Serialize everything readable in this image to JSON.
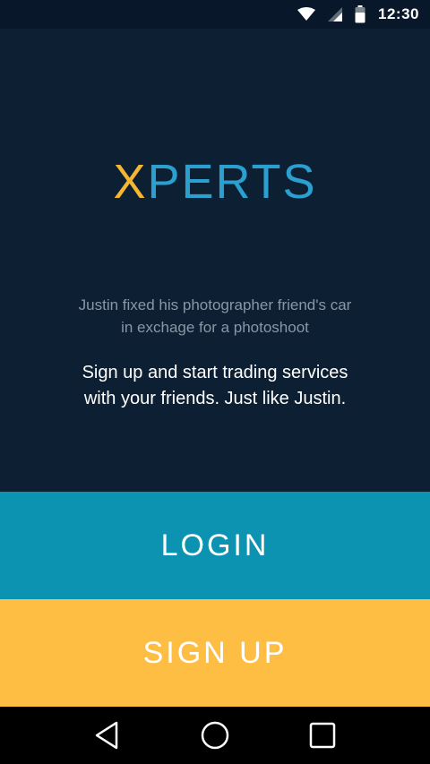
{
  "status_bar": {
    "time": "12:30",
    "icons": [
      "wifi-icon",
      "cell-signal-icon",
      "battery-icon"
    ]
  },
  "logo": {
    "first_letter": "X",
    "rest": "PERTS",
    "colors": {
      "x": "#f5b731",
      "rest": "#2a9fd0"
    }
  },
  "story": {
    "line1": "Justin fixed his photographer friend's car",
    "line2": "in exchage for a  photoshoot"
  },
  "cta": {
    "line1": "Sign up and start trading services",
    "line2": "with your friends. Just like Justin."
  },
  "buttons": {
    "login_label": "LOGIN",
    "signup_label": "SIGN UP"
  },
  "colors": {
    "background": "#0d2033",
    "login": "#0b93b1",
    "signup": "#fdbe43"
  },
  "nav_bar": {
    "icons": [
      "back-icon",
      "home-icon",
      "recents-icon"
    ]
  }
}
